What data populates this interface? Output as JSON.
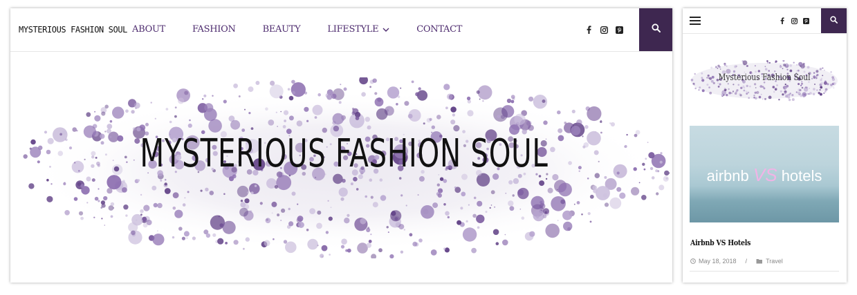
{
  "desktop": {
    "logo": "Mysterious Fashion Soul",
    "nav": [
      {
        "label": "About"
      },
      {
        "label": "Fashion"
      },
      {
        "label": "Beauty"
      },
      {
        "label": "Lifestyle"
      },
      {
        "label": "Contact"
      }
    ],
    "social_icons": [
      "facebook-icon",
      "instagram-icon",
      "pinterest-icon"
    ],
    "search_icon": "search-icon",
    "banner_title": "Mysterious Fashion Soul",
    "accent_color": "#3e2750",
    "nav_color": "#4d2b6e"
  },
  "mobile": {
    "menu_icon": "hamburger-icon",
    "social_icons": [
      "facebook-icon",
      "instagram-icon",
      "pinterest-icon"
    ],
    "search_icon": "search-icon",
    "logo_text": "Mysterious Fashion Soul",
    "post": {
      "image_text_left": "airbnb",
      "image_text_mid": "VS",
      "image_text_right": "hotels",
      "title": "Airbnb VS Hotels",
      "date": "May 18, 2018",
      "separator": "/",
      "category": "Travel"
    }
  }
}
